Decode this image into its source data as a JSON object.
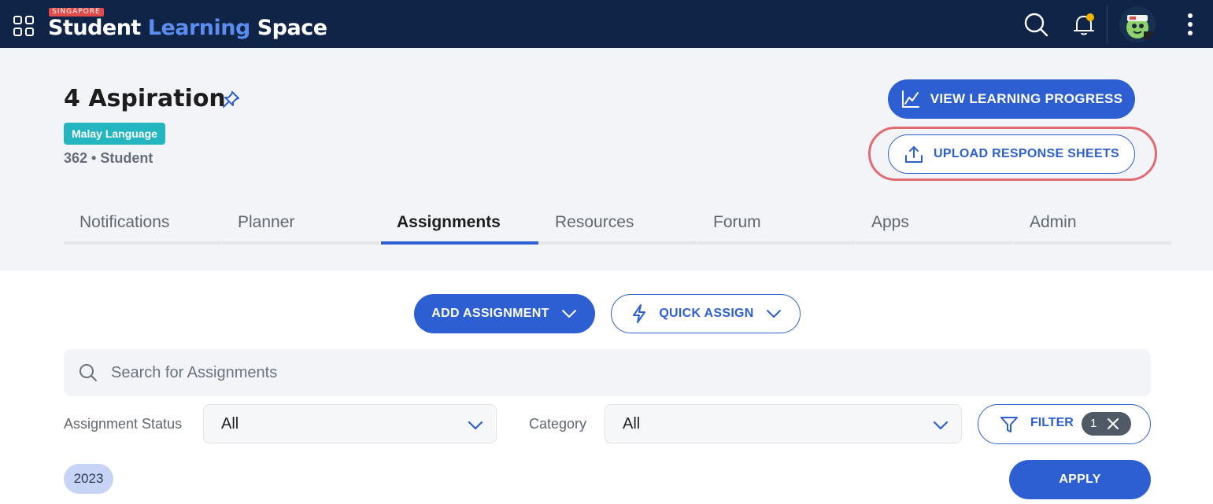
{
  "topbar": {
    "logo_tag": "SINGAPORE",
    "logo_word1": "Student",
    "logo_word2": "Learning",
    "logo_word3": "Space",
    "icons": [
      "apps-grid-icon",
      "search-icon",
      "bell-icon",
      "avatar",
      "more-vertical-icon"
    ],
    "notification_dot_color": "#f5b400"
  },
  "class": {
    "title": "4 Aspiration",
    "subject": "Malay Language",
    "meta": "362 • Student"
  },
  "actions": {
    "view_progress": "VIEW LEARNING PROGRESS",
    "upload_sheets": "UPLOAD RESPONSE SHEETS"
  },
  "tabs": [
    {
      "label": "Notifications",
      "active": false
    },
    {
      "label": "Planner",
      "active": false
    },
    {
      "label": "Assignments",
      "active": true
    },
    {
      "label": "Resources",
      "active": false
    },
    {
      "label": "Forum",
      "active": false
    },
    {
      "label": "Apps",
      "active": false
    },
    {
      "label": "Admin",
      "active": false
    }
  ],
  "content": {
    "add_assignment": "ADD ASSIGNMENT",
    "quick_assign": "QUICK ASSIGN",
    "search_placeholder": "Search for Assignments",
    "status_label": "Assignment Status",
    "status_value": "All",
    "category_label": "Category",
    "category_value": "All",
    "filter_label": "FILTER",
    "filter_count": "1",
    "year_chip": "2023",
    "apply_label": "APPLY"
  },
  "colors": {
    "topbar_bg": "#0f2446",
    "primary": "#2d5fd3",
    "highlight": "#e06b70",
    "subject_badge": "#23b5c0"
  }
}
